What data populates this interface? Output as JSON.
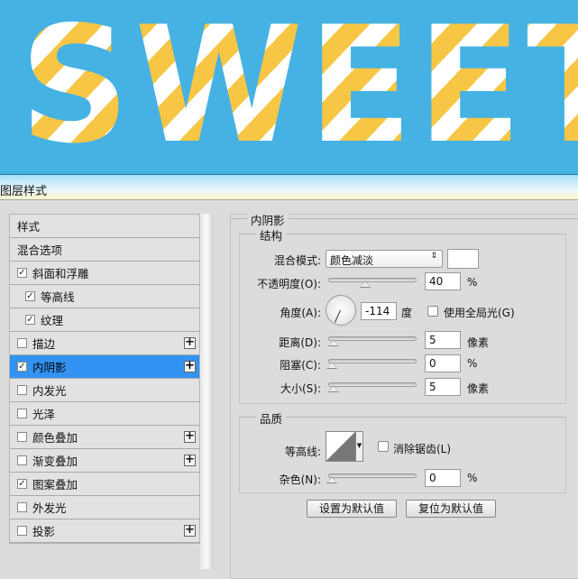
{
  "banner": {
    "text": "SWEET"
  },
  "dialog_title": "图层样式",
  "sidebar": {
    "items": [
      {
        "label": "样式",
        "checkbox": false,
        "checked": false,
        "plus": false,
        "indent": false,
        "selected": false
      },
      {
        "label": "混合选项",
        "checkbox": false,
        "checked": false,
        "plus": false,
        "indent": false,
        "selected": false
      },
      {
        "label": "斜面和浮雕",
        "checkbox": true,
        "checked": true,
        "plus": false,
        "indent": false,
        "selected": false
      },
      {
        "label": "等高线",
        "checkbox": true,
        "checked": true,
        "plus": false,
        "indent": true,
        "selected": false
      },
      {
        "label": "纹理",
        "checkbox": true,
        "checked": true,
        "plus": false,
        "indent": true,
        "selected": false
      },
      {
        "label": "描边",
        "checkbox": true,
        "checked": false,
        "plus": true,
        "indent": false,
        "selected": false
      },
      {
        "label": "内阴影",
        "checkbox": true,
        "checked": true,
        "plus": true,
        "indent": false,
        "selected": true
      },
      {
        "label": "内发光",
        "checkbox": true,
        "checked": false,
        "plus": false,
        "indent": false,
        "selected": false
      },
      {
        "label": "光泽",
        "checkbox": true,
        "checked": false,
        "plus": false,
        "indent": false,
        "selected": false
      },
      {
        "label": "颜色叠加",
        "checkbox": true,
        "checked": false,
        "plus": true,
        "indent": false,
        "selected": false
      },
      {
        "label": "渐变叠加",
        "checkbox": true,
        "checked": false,
        "plus": true,
        "indent": false,
        "selected": false
      },
      {
        "label": "图案叠加",
        "checkbox": true,
        "checked": true,
        "plus": false,
        "indent": false,
        "selected": false
      },
      {
        "label": "外发光",
        "checkbox": true,
        "checked": false,
        "plus": false,
        "indent": false,
        "selected": false
      },
      {
        "label": "投影",
        "checkbox": true,
        "checked": false,
        "plus": true,
        "indent": false,
        "selected": false
      }
    ]
  },
  "panel": {
    "title": "内阴影",
    "structure": {
      "title": "结构",
      "blend_mode_label": "混合模式:",
      "blend_mode_value": "颜色减淡",
      "color": "#ffffff",
      "opacity_label": "不透明度(O):",
      "opacity_value": "40",
      "opacity_unit": "%",
      "opacity_pct": 40,
      "angle_label": "角度(A):",
      "angle_value": "-114",
      "angle_unit": "度",
      "global_light_label": "使用全局光(G)",
      "global_light_checked": false,
      "distance_label": "距离(D):",
      "distance_value": "5",
      "distance_unit": "像素",
      "distance_pct": 2,
      "choke_label": "阻塞(C):",
      "choke_value": "0",
      "choke_unit": "%",
      "choke_pct": 0,
      "size_label": "大小(S):",
      "size_value": "5",
      "size_unit": "像素",
      "size_pct": 2
    },
    "quality": {
      "title": "品质",
      "contour_label": "等高线:",
      "antialias_label": "消除锯齿(L)",
      "antialias_checked": false,
      "noise_label": "杂色(N):",
      "noise_value": "0",
      "noise_unit": "%",
      "noise_pct": 0
    },
    "make_default": "设置为默认值",
    "reset_default": "复位为默认值"
  }
}
